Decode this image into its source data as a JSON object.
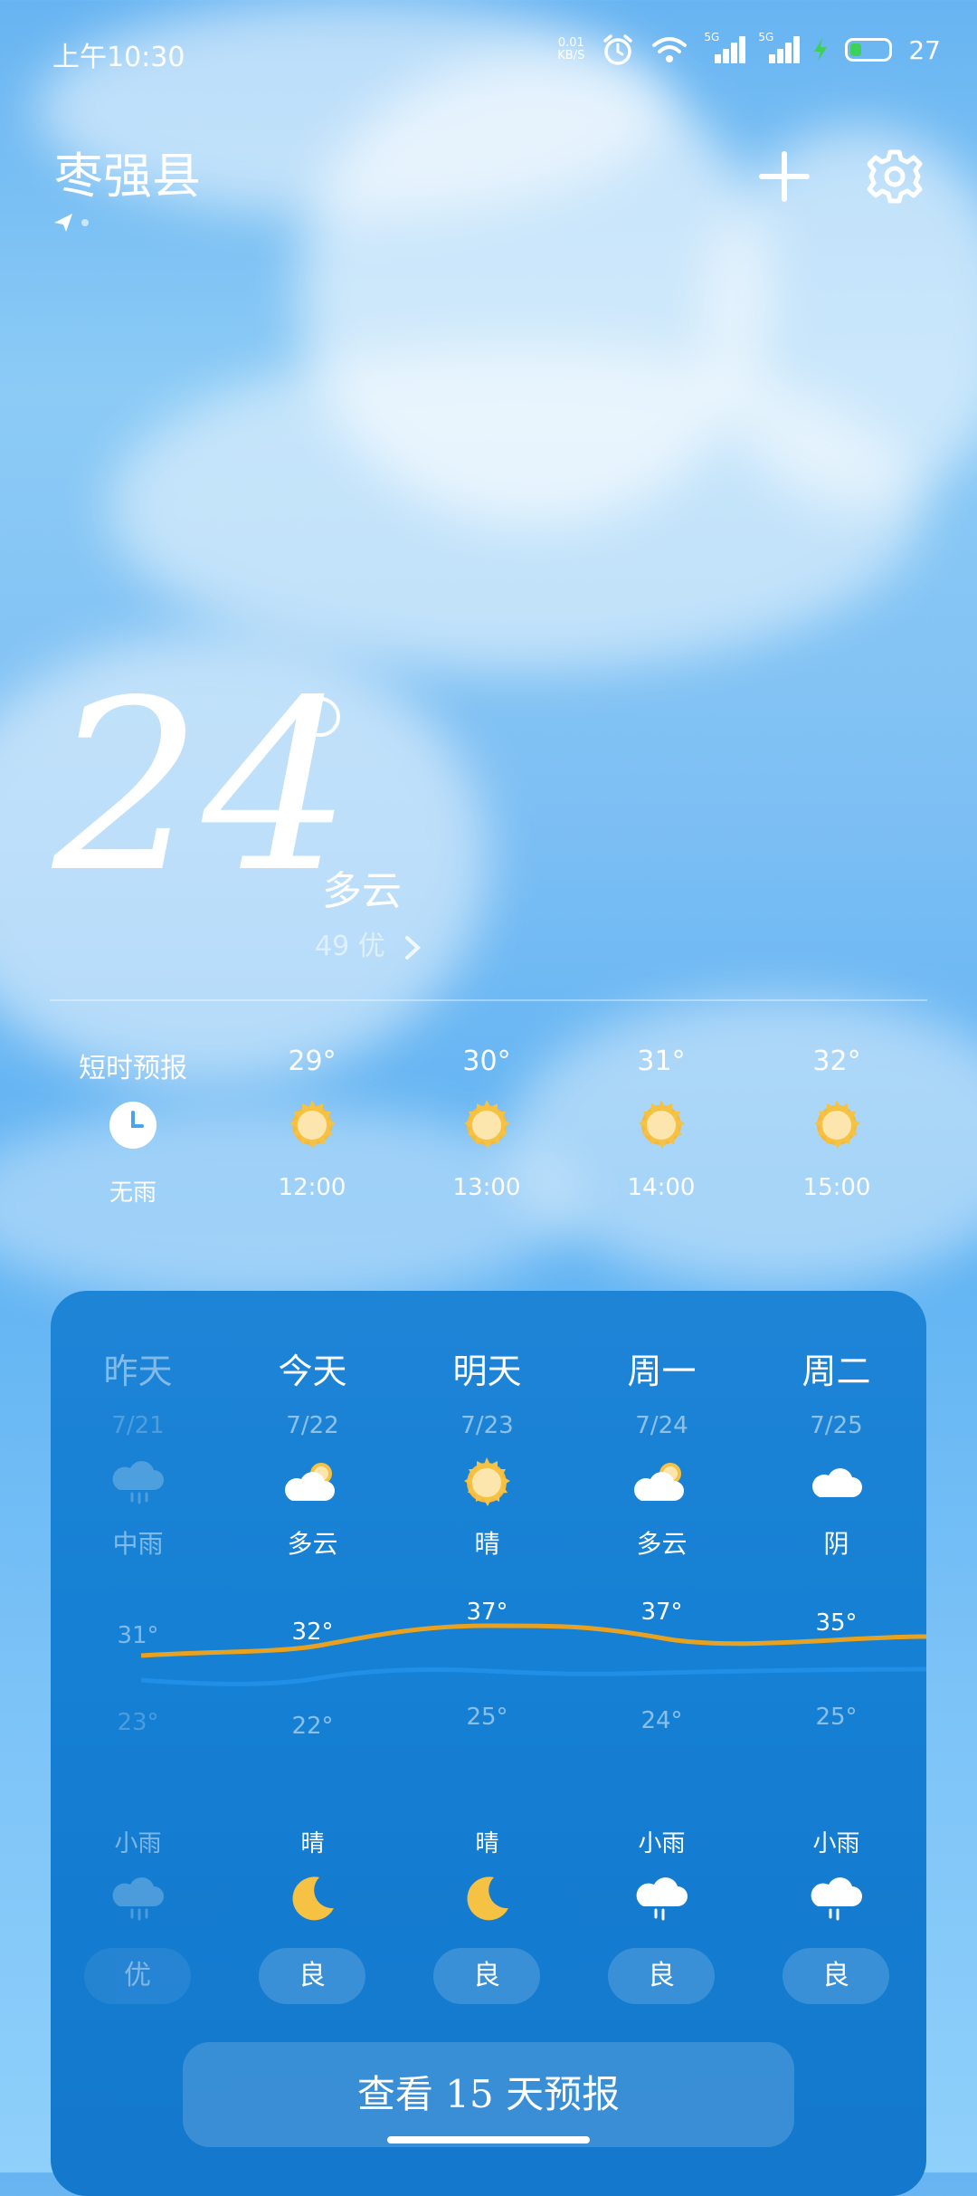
{
  "status": {
    "time": "上午10:30",
    "speed": "0.01",
    "speed_unit": "KB/S",
    "sig1": "5G",
    "sig2": "5G",
    "battery": "27"
  },
  "header": {
    "city": "枣强县",
    "add_icon": "plus-icon",
    "settings_icon": "gear-icon"
  },
  "current": {
    "temp": "24",
    "condition": "多云",
    "aqi": "49 优"
  },
  "hourly": [
    {
      "top": "短时预报",
      "icon": "clock",
      "bottom": "无雨"
    },
    {
      "top": "29°",
      "icon": "sun",
      "bottom": "12:00"
    },
    {
      "top": "30°",
      "icon": "sun",
      "bottom": "13:00"
    },
    {
      "top": "31°",
      "icon": "sun",
      "bottom": "14:00"
    },
    {
      "top": "32°",
      "icon": "sun",
      "bottom": "15:00"
    }
  ],
  "daily": [
    {
      "day": "昨天",
      "date": "7/21",
      "icon": "rain",
      "cond": "中雨",
      "high": "31°",
      "low": "23°",
      "night_cond": "小雨",
      "night_icon": "rain",
      "aqi": "优"
    },
    {
      "day": "今天",
      "date": "7/22",
      "icon": "partly",
      "cond": "多云",
      "high": "32°",
      "low": "22°",
      "night_cond": "晴",
      "night_icon": "moon",
      "aqi": "良"
    },
    {
      "day": "明天",
      "date": "7/23",
      "icon": "sun",
      "cond": "晴",
      "high": "37°",
      "low": "25°",
      "night_cond": "晴",
      "night_icon": "moon",
      "aqi": "良"
    },
    {
      "day": "周一",
      "date": "7/24",
      "icon": "partly",
      "cond": "多云",
      "high": "37°",
      "low": "24°",
      "night_cond": "小雨",
      "night_icon": "rain-white",
      "aqi": "良"
    },
    {
      "day": "周二",
      "date": "7/25",
      "icon": "cloud",
      "cond": "阴",
      "high": "35°",
      "low": "25°",
      "night_cond": "小雨",
      "night_icon": "rain-white",
      "aqi": "良"
    }
  ],
  "more_button": "查看 15 天预报",
  "colors": {
    "high_line": "#e8a21f",
    "low_line": "#1f8fe8",
    "card": "#1580d4"
  }
}
